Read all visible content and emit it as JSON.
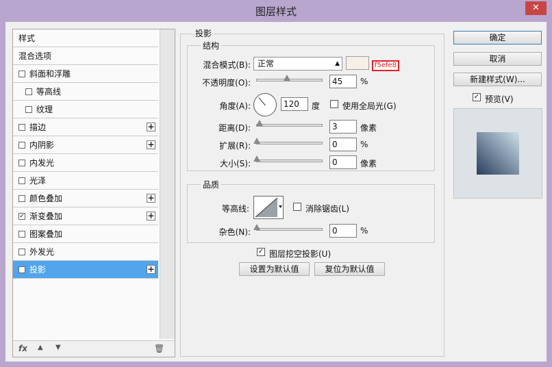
{
  "window": {
    "title": "图层样式",
    "close": "✕"
  },
  "left_panel": {
    "items": [
      {
        "label": "样式",
        "checkbox": false,
        "checked": false,
        "plus": false,
        "indent": 0
      },
      {
        "label": "混合选项",
        "checkbox": false,
        "checked": false,
        "plus": false,
        "indent": 0
      },
      {
        "label": "斜面和浮雕",
        "checkbox": true,
        "checked": false,
        "plus": false,
        "indent": 0
      },
      {
        "label": "等高线",
        "checkbox": true,
        "checked": false,
        "plus": false,
        "indent": 1
      },
      {
        "label": "纹理",
        "checkbox": true,
        "checked": false,
        "plus": false,
        "indent": 1
      },
      {
        "label": "描边",
        "checkbox": true,
        "checked": false,
        "plus": true,
        "indent": 0
      },
      {
        "label": "内阴影",
        "checkbox": true,
        "checked": false,
        "plus": true,
        "indent": 0
      },
      {
        "label": "内发光",
        "checkbox": true,
        "checked": false,
        "plus": false,
        "indent": 0
      },
      {
        "label": "光泽",
        "checkbox": true,
        "checked": false,
        "plus": false,
        "indent": 0
      },
      {
        "label": "颜色叠加",
        "checkbox": true,
        "checked": false,
        "plus": true,
        "indent": 0
      },
      {
        "label": "渐变叠加",
        "checkbox": true,
        "checked": true,
        "plus": true,
        "indent": 0
      },
      {
        "label": "图案叠加",
        "checkbox": true,
        "checked": false,
        "plus": false,
        "indent": 0
      },
      {
        "label": "外发光",
        "checkbox": true,
        "checked": false,
        "plus": false,
        "indent": 0
      },
      {
        "label": "投影",
        "checkbox": true,
        "checked": true,
        "plus": true,
        "indent": 0,
        "selected": true
      }
    ],
    "fx_label": "fx",
    "up_icon": "▲",
    "down_icon": "▼",
    "trash_icon": "🗑"
  },
  "drop_shadow": {
    "title": "投影",
    "structure": {
      "title": "结构",
      "blend_mode_label": "混合模式(B):",
      "blend_mode_value": "正常",
      "color_hex": "f5efe8",
      "color_value": "#f5efe8",
      "opacity_label": "不透明度(O):",
      "opacity_value": "45",
      "opacity_unit": "%",
      "opacity_fraction": 0.45,
      "angle_label": "角度(A):",
      "angle_value": "120",
      "angle_unit": "度",
      "global_light_label": "使用全局光(G)",
      "distance_label": "距离(D):",
      "distance_value": "3",
      "distance_unit": "像素",
      "spread_label": "扩展(R):",
      "spread_value": "0",
      "spread_unit": "%",
      "size_label": "大小(S):",
      "size_value": "0",
      "size_unit": "像素"
    },
    "quality": {
      "title": "品质",
      "contour_label": "等高线:",
      "antialias_label": "消除锯齿(L)",
      "noise_label": "杂色(N):",
      "noise_value": "0",
      "noise_unit": "%"
    },
    "knockout_label": "图层挖空投影(U)",
    "set_default": "设置为默认值",
    "reset_default": "复位为默认值"
  },
  "buttons": {
    "ok": "确定",
    "cancel": "取消",
    "new_style": "新建样式(W)...",
    "preview_label": "预览(V)"
  },
  "colors": {
    "accent": "#50a5ec",
    "titlebar": "#b9a6cf",
    "hex_highlight": "#e0202a"
  }
}
